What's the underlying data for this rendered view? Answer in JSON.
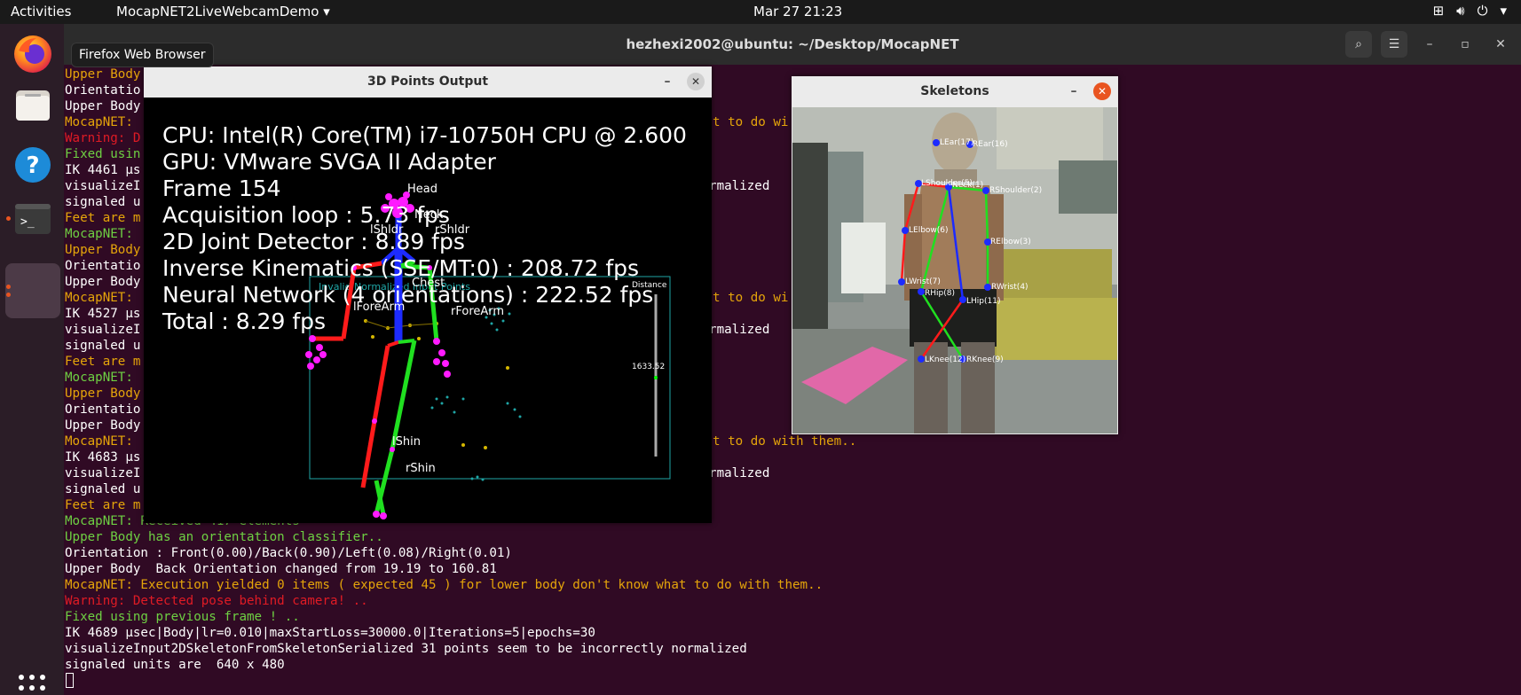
{
  "topbar": {
    "activities": "Activities",
    "app_menu": "MocapNET2LiveWebcamDemo ▾",
    "clock": "Mar 27  21:23",
    "tray_icons": [
      "network-icon",
      "volume-icon",
      "power-icon"
    ]
  },
  "dock": {
    "tooltip": "Firefox Web Browser",
    "items": [
      "firefox-icon",
      "files-icon",
      "help-icon",
      "terminal-icon",
      "running-app-icon"
    ]
  },
  "terminal": {
    "title": "hezhexi2002@ubuntu: ~/Desktop/MocapNET",
    "lines": [
      {
        "c": "c-orange",
        "t": "Upper Body"
      },
      {
        "c": "c-white",
        "t": "Orientatio"
      },
      {
        "c": "c-white",
        "t": "Upper Body"
      },
      {
        "c": "c-mnet",
        "t": "MocapNET:"
      },
      {
        "c": "c-red",
        "t": "Warning: D"
      },
      {
        "c": "c-green",
        "t": "Fixed usin"
      },
      {
        "c": "c-white",
        "t": "IK 4461 μs"
      },
      {
        "c": "c-white",
        "t": "visualizeI                                                                          ormalized"
      },
      {
        "c": "c-white",
        "t": "signaled u"
      },
      {
        "c": "c-mnet",
        "t": "Feet are m"
      },
      {
        "c": "c-green",
        "t": "MocapNET:"
      },
      {
        "c": "c-orange",
        "t": "Upper Body"
      },
      {
        "c": "c-white",
        "t": "Orientatio"
      },
      {
        "c": "c-white",
        "t": "Upper Body"
      },
      {
        "c": "c-mnet",
        "t": "MocapNET:"
      },
      {
        "c": "c-white",
        "t": "IK 4527 μs"
      },
      {
        "c": "c-white",
        "t": "visualizeI                                                                          ormalized"
      },
      {
        "c": "c-white",
        "t": "signaled u"
      },
      {
        "c": "c-mnet",
        "t": "Feet are m"
      },
      {
        "c": "c-green",
        "t": "MocapNET:"
      },
      {
        "c": "c-orange",
        "t": "Upper Body"
      },
      {
        "c": "c-white",
        "t": "Orientatio"
      },
      {
        "c": "c-white",
        "t": "Upper Body"
      },
      {
        "c": "c-mnet",
        "t": "MocapNET:"
      },
      {
        "c": "c-white",
        "t": "IK 4683 μs"
      },
      {
        "c": "c-white",
        "t": "visualizeI                                                                          ormalized"
      },
      {
        "c": "c-white",
        "t": "signaled u"
      },
      {
        "c": "c-mnet",
        "t": "Feet are m"
      },
      {
        "c": "c-green",
        "t": "MocapNET: Received 417 elements"
      },
      {
        "c": "c-green",
        "t": "Upper Body has an orientation classifier.."
      },
      {
        "c": "c-white",
        "t": "Orientation : Front(0.00)/Back(0.90)/Left(0.08)/Right(0.01)"
      },
      {
        "c": "c-white",
        "t": "Upper Body  Back Orientation changed from 19.19 to 160.81"
      },
      {
        "c": "c-mnet",
        "t": "MocapNET: Execution yielded 0 items ( expected 45 ) for lower body don't know what to do with them.."
      },
      {
        "c": "c-red",
        "t": "Warning: Detected pose behind camera! .."
      },
      {
        "c": "c-green",
        "t": "Fixed using previous frame ! .."
      },
      {
        "c": "c-white",
        "t": "IK 4689 μsec|Body|lr=0.010|maxStartLoss=30000.0|Iterations=5|epochs=30"
      },
      {
        "c": "c-white",
        "t": "visualizeInput2DSkeletonFromSkeletonSerialized 31 points seem to be incorrectly normalized"
      },
      {
        "c": "c-white",
        "t": "signaled units are  640 x 480"
      }
    ],
    "right_fragments": [
      "t to do wi",
      "t to do wi",
      "t to do with them.."
    ]
  },
  "window_3d": {
    "title": "3D Points Output",
    "stats": [
      "CPU: Intel(R) Core(TM) i7-10750H CPU @ 2.600",
      "GPU: VMware SVGA II Adapter",
      "Frame 154",
      "Acquisition loop : 5.73 fps",
      "2D Joint Detector : 8.89 fps",
      "Inverse Kinematics (SSE/MT:0) : 208.72 fps",
      "Neural Network (4 orientations) : 222.52 fps",
      "Total : 8.29 fps"
    ],
    "joint_labels": [
      "Head",
      "Neck",
      "lShldr",
      "rShldr",
      "Chest",
      "lForeArm",
      "rForeArm",
      "lShin",
      "rShin"
    ],
    "input_label": "Invalid Normalized Input Points",
    "distance_label": "Distance",
    "distance_value": "1633.52"
  },
  "window_skeletons": {
    "title": "Skeletons",
    "joint_labels": [
      "LEar(17)",
      "REar(16)",
      "LShoulder(5)",
      "Neck(1)",
      "RShoulder(2)",
      "LElbow(6)",
      "RElbow(3)",
      "LWrist(7)",
      "RWrist(4)",
      "RHip(8)",
      "LHip(11)",
      "LKnee(12)",
      "RKnee(9)"
    ]
  }
}
